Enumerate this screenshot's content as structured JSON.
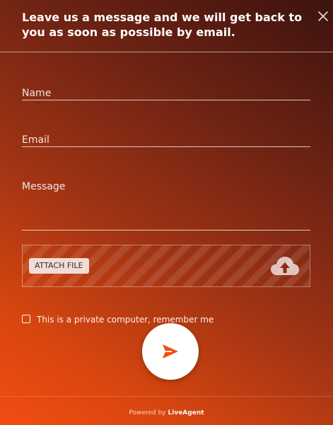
{
  "header": {
    "title": "Leave us a message and we will get back to you as soon as possible by email."
  },
  "form": {
    "name_placeholder": "Name",
    "email_placeholder": "Email",
    "message_placeholder": "Message",
    "attach_label": "ATTACH FILE",
    "remember_label": "This is a private computer, remember me"
  },
  "footer": {
    "powered_by": "Powered by",
    "brand": "LiveAgent"
  },
  "icons": {
    "close": "close-icon",
    "upload": "cloud-upload-icon",
    "send": "send-icon"
  },
  "colors": {
    "gradient_dark": "#3d130f",
    "gradient_light": "#f14d12",
    "send_arrow": "#f04e12",
    "attach_button_bg": "#f3dcd6"
  }
}
